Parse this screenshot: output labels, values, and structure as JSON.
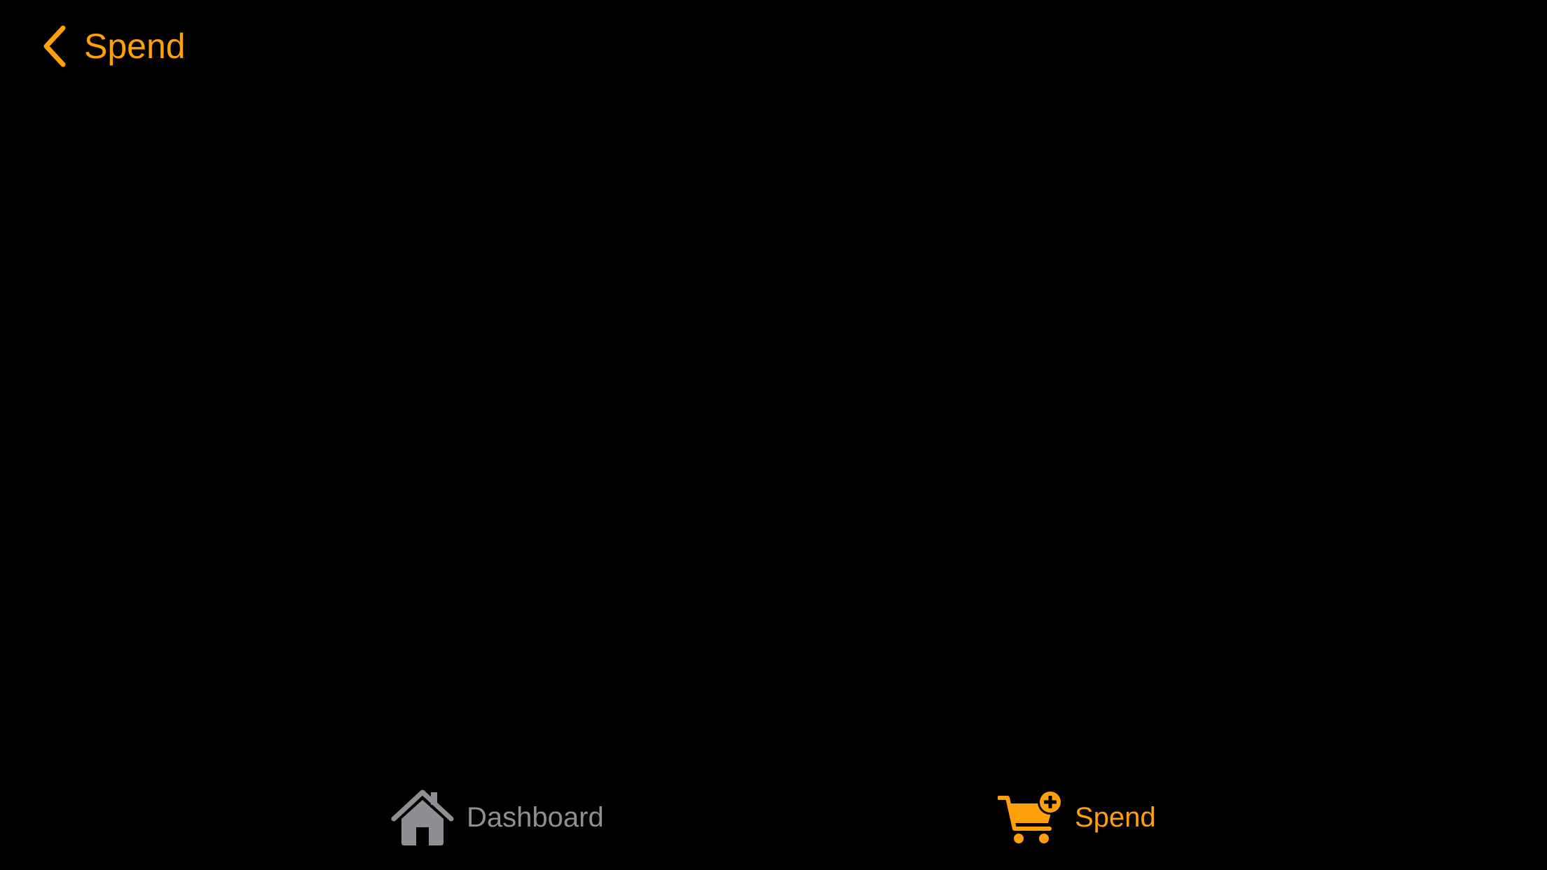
{
  "nav": {
    "back_label": "Spend",
    "back_icon": "chevron-left-icon"
  },
  "tabs": [
    {
      "label": "Dashboard",
      "icon": "house-icon",
      "selected": false
    },
    {
      "label": "Spend",
      "icon": "cart-plus-icon",
      "selected": true
    }
  ],
  "colors": {
    "background": "#000000",
    "accent": "#FF9F0A",
    "inactive": "#8E8E93"
  }
}
